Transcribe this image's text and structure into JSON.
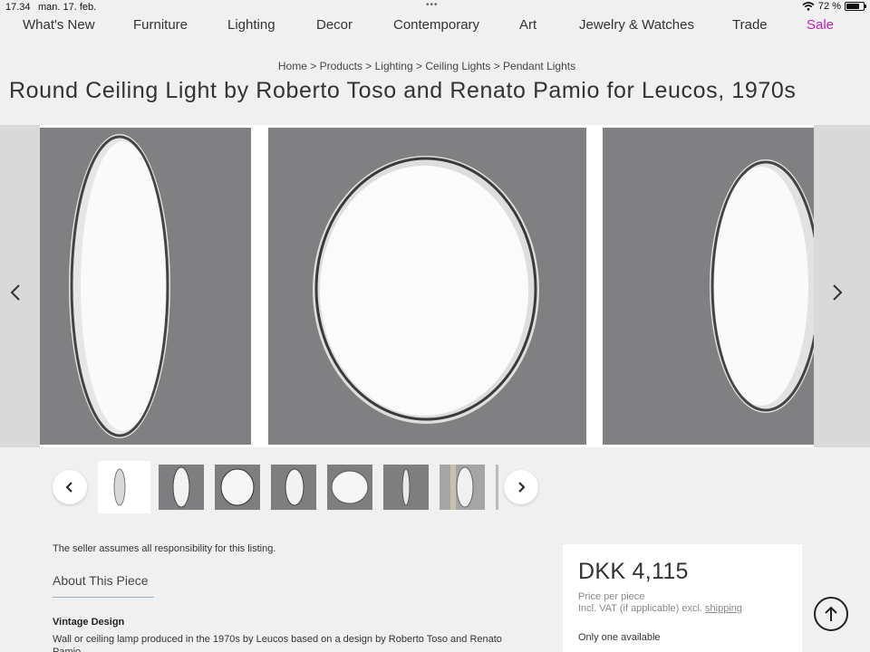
{
  "statusbar": {
    "time": "17.34",
    "date": "man. 17. feb.",
    "battery": "72 %"
  },
  "nav": {
    "items": [
      "What's New",
      "Furniture",
      "Lighting",
      "Decor",
      "Contemporary",
      "Art",
      "Jewelry & Watches",
      "Trade"
    ],
    "sale": "Sale",
    "sale_color": "#c21fbf"
  },
  "breadcrumb": "Home > Products > Lighting > Ceiling Lights > Pendant Lights",
  "title": "Round Ceiling Light by Roberto Toso and Renato Pamio for Leucos, 1970s",
  "gallery": {
    "prev_icon": "chevron-left-icon",
    "next_icon": "chevron-right-icon",
    "thumbnail_count": 7
  },
  "seller_note": "The seller assumes all responsibility for this listing.",
  "about": {
    "title": "About This Piece",
    "subtitle": "Vintage Design",
    "description": "Wall or ceiling lamp produced in the 1970s by Leucos based on a design by Roberto Toso and Renato Pamio."
  },
  "pricing": {
    "price": "DKK 4,115",
    "per": "Price per piece",
    "vat_prefix": "Incl. VAT (if applicable) excl.",
    "shipping_link": "shipping",
    "availability": "Only one available"
  }
}
